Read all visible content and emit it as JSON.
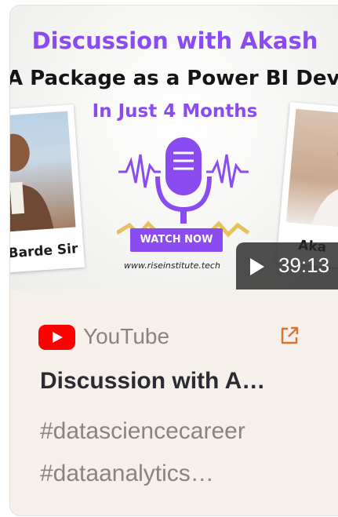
{
  "thumbnail": {
    "title": "Discussion with Akash",
    "headline": "A Package as a Power BI Dev",
    "subheadline": "In Just 4 Months",
    "left_caption": "Barde Sir",
    "right_caption": "Aka",
    "watch_button": "WATCH NOW",
    "site_url": "www.riseinstitute.tech",
    "duration": "39:13"
  },
  "card": {
    "source": "YouTube",
    "title": "Discussion with A…",
    "tags_line1": "#datasciencecareer",
    "tags_line2": "#dataanalytics…"
  },
  "colors": {
    "accent_purple": "#8a4cf0",
    "youtube_red": "#ff0000",
    "external_link_orange": "#e0712b",
    "card_bg": "#f6f0ea"
  },
  "icons": {
    "play": "play-icon",
    "youtube": "youtube-logo-icon",
    "external_link": "external-link-icon",
    "microphone": "microphone-icon"
  }
}
